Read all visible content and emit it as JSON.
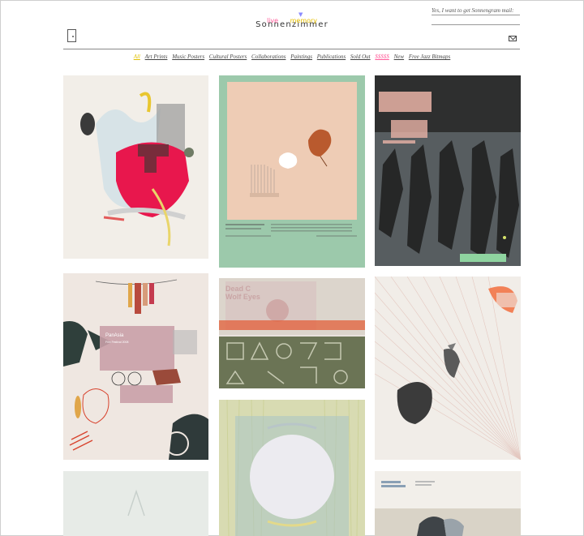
{
  "site": {
    "title": "Sonnenzimmer",
    "arrow": "▼",
    "live": "live",
    "memory": "memory"
  },
  "newsletter": {
    "label": "Yes, I want to get Sonnengram mail:",
    "placeholder": ""
  },
  "nav": {
    "items": [
      {
        "label": "All"
      },
      {
        "label": "Art Prints"
      },
      {
        "label": "Music Posters"
      },
      {
        "label": "Cultural Posters"
      },
      {
        "label": "Collaborations"
      },
      {
        "label": "Paintings"
      },
      {
        "label": "Publications"
      },
      {
        "label": "Sold Out"
      },
      {
        "label": "$$$$$"
      },
      {
        "label": "New"
      },
      {
        "label": "Free Jazz Bitmaps"
      }
    ]
  },
  "tiles": {
    "panasia_title": "PanAsia",
    "panasia_sub": "Film Festival 2008",
    "deadc_title": "Dead C",
    "deadc_sub": "Wolf Eyes"
  },
  "colors": {
    "accent_active": "#e0c000",
    "accent_money": "#ff5c9a",
    "live": "#ff5c9a",
    "memory": "#e8c000"
  }
}
